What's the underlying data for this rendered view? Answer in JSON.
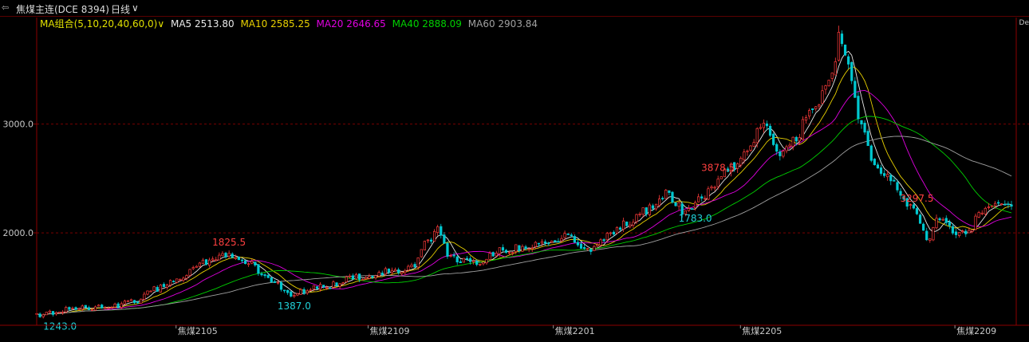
{
  "titlebar": {
    "icon": "⇦",
    "title": "焦煤主连(DCE 8394)",
    "period": "日线",
    "caret": "∨"
  },
  "corner_label": "De",
  "colors": {
    "up": "#ff3b3b",
    "down": "#00c8d0",
    "grid": "#7a0000",
    "axis": "#8b0000"
  },
  "ma_legend": [
    {
      "label": "MA组合(5,10,20,40,60,0)∨",
      "color": "#e0e000"
    },
    {
      "label": "MA5 2513.80",
      "color": "#e8e8e8"
    },
    {
      "label": "MA10 2585.25",
      "color": "#e8d000"
    },
    {
      "label": "MA20 2646.65",
      "color": "#e000e0"
    },
    {
      "label": "MA40 2888.09",
      "color": "#00d000"
    },
    {
      "label": "MA60 2903.84",
      "color": "#a0a0a0"
    }
  ],
  "chart_data": {
    "type": "candlestick",
    "y_ticks": [
      {
        "value": 2000,
        "label": "2000.0"
      },
      {
        "value": 3000,
        "label": "3000.0"
      }
    ],
    "ylim": [
      1150,
      3980
    ],
    "x_ticks": [
      {
        "label": "焦煤2105",
        "frac": 0.143
      },
      {
        "label": "焦煤2109",
        "frac": 0.34
      },
      {
        "label": "焦煤2201",
        "frac": 0.53
      },
      {
        "label": "焦煤2205",
        "frac": 0.722
      },
      {
        "label": "焦煤2209",
        "frac": 0.942
      }
    ],
    "anchors": [
      [
        0.0,
        1248
      ],
      [
        0.04,
        1310
      ],
      [
        0.08,
        1330
      ],
      [
        0.1,
        1370
      ],
      [
        0.12,
        1480
      ],
      [
        0.145,
        1580
      ],
      [
        0.168,
        1720
      ],
      [
        0.195,
        1790
      ],
      [
        0.215,
        1730
      ],
      [
        0.24,
        1560
      ],
      [
        0.262,
        1430
      ],
      [
        0.28,
        1480
      ],
      [
        0.3,
        1520
      ],
      [
        0.33,
        1600
      ],
      [
        0.36,
        1640
      ],
      [
        0.385,
        1680
      ],
      [
        0.4,
        1900
      ],
      [
        0.41,
        2030
      ],
      [
        0.425,
        1760
      ],
      [
        0.45,
        1720
      ],
      [
        0.475,
        1830
      ],
      [
        0.5,
        1870
      ],
      [
        0.52,
        1940
      ],
      [
        0.545,
        1960
      ],
      [
        0.562,
        1840
      ],
      [
        0.585,
        1960
      ],
      [
        0.61,
        2110
      ],
      [
        0.625,
        2210
      ],
      [
        0.645,
        2350
      ],
      [
        0.665,
        2200
      ],
      [
        0.685,
        2350
      ],
      [
        0.705,
        2550
      ],
      [
        0.725,
        2700
      ],
      [
        0.745,
        2980
      ],
      [
        0.76,
        2720
      ],
      [
        0.775,
        2830
      ],
      [
        0.795,
        3100
      ],
      [
        0.815,
        3450
      ],
      [
        0.825,
        3820
      ],
      [
        0.835,
        3480
      ],
      [
        0.845,
        3010
      ],
      [
        0.855,
        2720
      ],
      [
        0.865,
        2600
      ],
      [
        0.88,
        2450
      ],
      [
        0.9,
        2200
      ],
      [
        0.915,
        1900
      ],
      [
        0.925,
        2150
      ],
      [
        0.94,
        2020
      ],
      [
        0.955,
        2010
      ],
      [
        0.97,
        2200
      ],
      [
        0.99,
        2300
      ],
      [
        1.0,
        2250
      ]
    ],
    "annotations": [
      {
        "label": "3878.5",
        "kind": "high"
      },
      {
        "label": "3297.5",
        "kind": "high"
      },
      {
        "label": "1825.5",
        "kind": "high"
      },
      {
        "label": "1387.0",
        "kind": "low"
      },
      {
        "label": "1783.0",
        "kind": "low"
      },
      {
        "label": "1243.0",
        "kind": "low"
      }
    ],
    "moving_averages": [
      {
        "name": "MA5",
        "value": 2513.8
      },
      {
        "name": "MA10",
        "value": 2585.25
      },
      {
        "name": "MA20",
        "value": 2646.65
      },
      {
        "name": "MA40",
        "value": 2888.09
      },
      {
        "name": "MA60",
        "value": 2903.84
      }
    ]
  }
}
